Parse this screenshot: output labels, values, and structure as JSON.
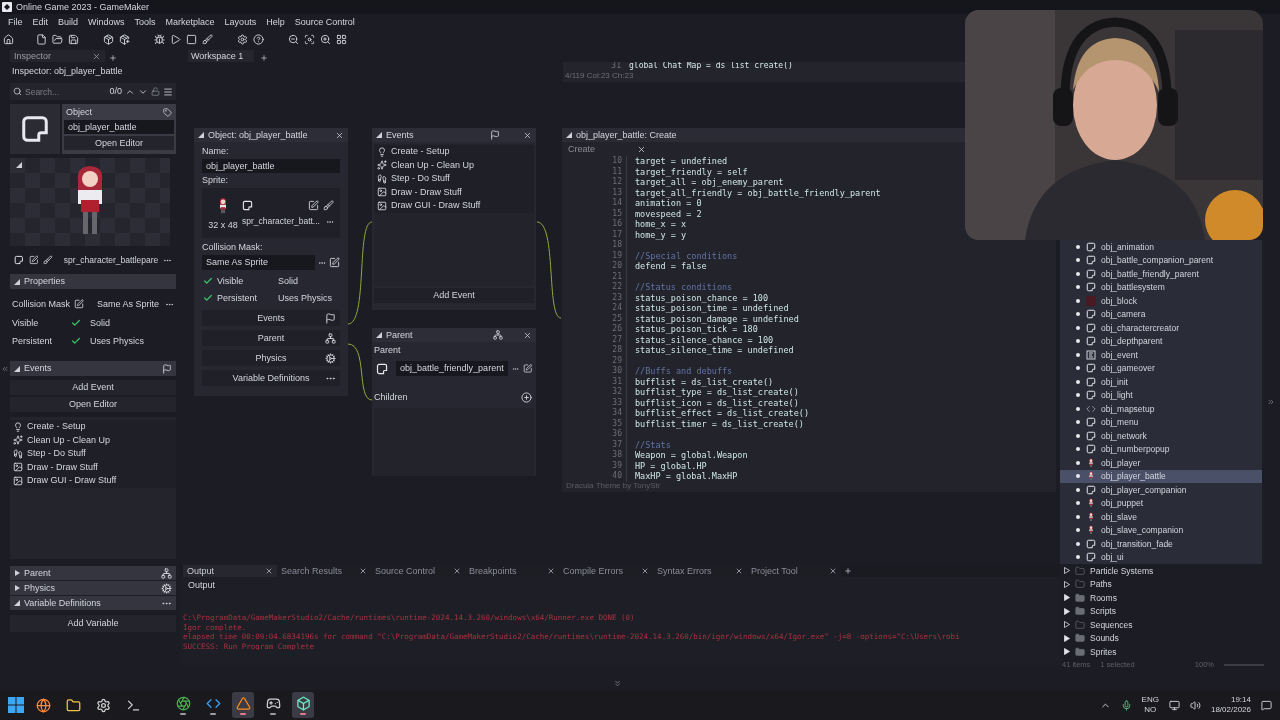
{
  "window": {
    "title": "Online Game 2023 - GameMaker"
  },
  "menu": [
    "File",
    "Edit",
    "Build",
    "Windows",
    "Tools",
    "Marketplace",
    "Layouts",
    "Help",
    "Source Control"
  ],
  "inspector": {
    "tab": "Inspector",
    "title": "Inspector: obj_player_battle",
    "search": {
      "placeholder": "Search...",
      "count": "0/0"
    },
    "object_label": "Object",
    "object_name": "obj_player_battle",
    "open_editor": "Open Editor",
    "sprite": "spr_character_battlepare",
    "properties": {
      "label": "Properties",
      "expanded": true,
      "collision_mask_label": "Collision Mask",
      "collision_mask": "Same As Sprite",
      "flags": [
        {
          "label": "Visible",
          "checked": true
        },
        {
          "label": "Solid",
          "checked": false
        },
        {
          "label": "Persistent",
          "checked": true
        },
        {
          "label": "Uses Physics",
          "checked": false
        }
      ]
    },
    "events": {
      "label": "Events",
      "expanded": true,
      "add_button": "Add Event",
      "open_button": "Open Editor",
      "items": [
        {
          "kind": "create",
          "label": "Create - Setup"
        },
        {
          "kind": "cleanup",
          "label": "Clean Up - Clean Up"
        },
        {
          "kind": "step",
          "label": "Step - Do Stuff"
        },
        {
          "kind": "draw",
          "label": "Draw - Draw Stuff"
        },
        {
          "kind": "draw",
          "label": "Draw GUI - Draw Stuff"
        }
      ]
    },
    "sections": [
      {
        "label": "Parent",
        "expanded": false,
        "kind": "parent"
      },
      {
        "label": "Physics",
        "expanded": false,
        "kind": "physics"
      },
      {
        "label": "Variable Definitions",
        "expanded": true,
        "kind": "more"
      }
    ],
    "add_variable": "Add Variable"
  },
  "workspace_tab": "Workspace 1",
  "background_editor": {
    "line_num": "31",
    "line": "global Chat Map = ds list create()",
    "status": "4/119 Col:23 Ch:23"
  },
  "object_window": {
    "title": "Object: obj_player_battle",
    "name_label": "Name:",
    "name": "obj_player_battle",
    "sprite_label": "Sprite:",
    "sprite": "spr_character_batt...",
    "sprite_size": "32 x 48",
    "collision_label": "Collision Mask:",
    "collision_mask": "Same As Sprite",
    "flags": [
      {
        "label": "Visible",
        "checked": true
      },
      {
        "label": "Solid",
        "checked": false
      },
      {
        "label": "Persistent",
        "checked": true
      },
      {
        "label": "Uses Physics",
        "checked": false
      }
    ],
    "buttons": [
      {
        "label": "Events",
        "kind": "events"
      },
      {
        "label": "Parent",
        "kind": "parent"
      },
      {
        "label": "Physics",
        "kind": "physics"
      },
      {
        "label": "Variable Definitions",
        "kind": "more"
      }
    ]
  },
  "events_window": {
    "title": "Events",
    "add_button": "Add Event",
    "items": [
      {
        "kind": "create",
        "label": "Create - Setup"
      },
      {
        "kind": "cleanup",
        "label": "Clean Up - Clean Up"
      },
      {
        "kind": "step",
        "label": "Step - Do Stuff"
      },
      {
        "kind": "draw",
        "label": "Draw - Draw Stuff"
      },
      {
        "kind": "draw",
        "label": "Draw GUI - Draw Stuff"
      }
    ]
  },
  "parent_window": {
    "title": "Parent",
    "parent_label": "Parent",
    "parent": "obj_battle_friendly_parent",
    "children_label": "Children"
  },
  "code_window": {
    "title": "obj_player_battle: Create",
    "tab": "Create",
    "footer": "Dracula Theme by TonyStr",
    "lines": [
      {
        "num": "10",
        "kind": "code",
        "text": "target = undefined"
      },
      {
        "num": "11",
        "kind": "code",
        "text": "target_friendly = self"
      },
      {
        "num": "12",
        "kind": "code",
        "text": "target_all = obj_enemy_parent"
      },
      {
        "num": "13",
        "kind": "code",
        "text": "target_all_friendly = obj_battle_friendly_parent"
      },
      {
        "num": "14",
        "kind": "code",
        "text": "animation = 0"
      },
      {
        "num": "15",
        "kind": "code",
        "text": "movespeed = 2"
      },
      {
        "num": "16",
        "kind": "code",
        "text": "home_x = x"
      },
      {
        "num": "17",
        "kind": "code",
        "text": "home_y = y"
      },
      {
        "num": "18"
      },
      {
        "num": "19",
        "kind": "comment",
        "text": "//Special conditions"
      },
      {
        "num": "20",
        "kind": "code",
        "text": "defend = false"
      },
      {
        "num": "21"
      },
      {
        "num": "22",
        "kind": "comment",
        "text": "//Status conditions"
      },
      {
        "num": "23",
        "kind": "code",
        "text": "status_poison_chance = 100"
      },
      {
        "num": "24",
        "kind": "code",
        "text": "status_poison_time = undefined"
      },
      {
        "num": "25",
        "kind": "code",
        "text": "status_poison_damage = undefined"
      },
      {
        "num": "26",
        "kind": "code",
        "text": "status_poison_tick = 180"
      },
      {
        "num": "27",
        "kind": "code",
        "text": "status_silence_chance = 100"
      },
      {
        "num": "28",
        "kind": "code",
        "text": "status_silence_time = undefined"
      },
      {
        "num": "29"
      },
      {
        "num": "30",
        "kind": "comment",
        "text": "//Buffs and debuffs"
      },
      {
        "num": "31",
        "kind": "code",
        "text": "bufflist = ds_list_create()"
      },
      {
        "num": "32",
        "kind": "code",
        "text": "bufflist_type = ds_list_create()"
      },
      {
        "num": "33",
        "kind": "code",
        "text": "bufflist_icon = ds_list_create()"
      },
      {
        "num": "34",
        "kind": "code",
        "text": "bufflist_effect = ds_list_create()"
      },
      {
        "num": "35",
        "kind": "code",
        "text": "bufflist_timer = ds_list_create()"
      },
      {
        "num": "36"
      },
      {
        "num": "37",
        "kind": "comment",
        "text": "//Stats"
      },
      {
        "num": "38",
        "kind": "code",
        "text": "Weapon = global.Weapon"
      },
      {
        "num": "39",
        "kind": "code",
        "text": "HP = global.HP"
      },
      {
        "num": "40",
        "kind": "code",
        "text": "MaxHP = global.MaxHP"
      }
    ]
  },
  "output": {
    "title": "Output",
    "tabs": [
      {
        "label": "Output",
        "selected": true
      },
      {
        "label": "Search Results",
        "selected": false
      },
      {
        "label": "Source Control",
        "selected": false
      },
      {
        "label": "Breakpoints",
        "selected": false
      },
      {
        "label": "Compile Errors",
        "selected": false
      },
      {
        "label": "Syntax Errors",
        "selected": false
      },
      {
        "label": "Project Tool",
        "selected": false
      }
    ],
    "lines": [
      "C:\\ProgramData/GameMakerStudio2/Cache/runtimes\\runtime-2024.14.3.260/windows\\x64/Runner.exe DONE (0)",
      "Igor complete.",
      "elapsed time 00:09:04.6834196s for command \"C:\\ProgramData/GameMakerStudio2/Cache/runtimes\\runtime-2024.14.3.260/bin/igor/windows/x64/Igor.exe\" -j=8  -options=\"C:\\Users\\robi",
      "SUCCESS: Run Program Complete"
    ]
  },
  "assets": {
    "items": [
      {
        "name": "obj_animation",
        "kind": "object",
        "selected": false
      },
      {
        "name": "obj_battle_companion_parent",
        "kind": "object",
        "selected": false
      },
      {
        "name": "obj_battle_friendly_parent",
        "kind": "object",
        "selected": false
      },
      {
        "name": "obj_battlesystem",
        "kind": "object",
        "selected": false
      },
      {
        "name": "obj_block",
        "kind": "solid",
        "selected": false
      },
      {
        "name": "obj_camera",
        "kind": "object",
        "selected": false
      },
      {
        "name": "obj_charactercreator",
        "kind": "object",
        "selected": false
      },
      {
        "name": "obj_depthparent",
        "kind": "object",
        "selected": false
      },
      {
        "name": "obj_event",
        "kind": "event",
        "selected": false
      },
      {
        "name": "obj_gameover",
        "kind": "object",
        "selected": false
      },
      {
        "name": "obj_init",
        "kind": "object",
        "selected": false
      },
      {
        "name": "obj_light",
        "kind": "object",
        "selected": false
      },
      {
        "name": "obj_mapsetup",
        "kind": "script",
        "selected": false
      },
      {
        "name": "obj_menu",
        "kind": "object",
        "selected": false
      },
      {
        "name": "obj_network",
        "kind": "object",
        "selected": false
      },
      {
        "name": "obj_numberpopup",
        "kind": "object",
        "selected": false
      },
      {
        "name": "obj_player",
        "kind": "sprite",
        "selected": false
      },
      {
        "name": "obj_player_battle",
        "kind": "sprite",
        "selected": true
      },
      {
        "name": "obj_player_companion",
        "kind": "object",
        "selected": false
      },
      {
        "name": "obj_puppet",
        "kind": "sprite",
        "selected": false
      },
      {
        "name": "obj_slave",
        "kind": "sprite",
        "selected": false
      },
      {
        "name": "obj_slave_companion",
        "kind": "sprite",
        "selected": false
      },
      {
        "name": "obj_transition_fade",
        "kind": "object",
        "selected": false
      },
      {
        "name": "obj_ui",
        "kind": "object",
        "selected": false
      }
    ],
    "folders": [
      {
        "name": "Particle Systems",
        "empty": true
      },
      {
        "name": "Paths",
        "empty": true
      },
      {
        "name": "Rooms",
        "empty": false
      },
      {
        "name": "Scripts",
        "empty": false
      },
      {
        "name": "Sequences",
        "empty": true
      },
      {
        "name": "Sounds",
        "empty": false
      },
      {
        "name": "Sprites",
        "empty": false
      }
    ],
    "status": {
      "items": "41 items",
      "selected": "1 selected",
      "zoom": "100%"
    }
  },
  "taskbar": {
    "apps": [
      {
        "kind": "browser",
        "running": false,
        "focused": false
      },
      {
        "kind": "files",
        "running": false,
        "focused": false
      },
      {
        "kind": "settings",
        "running": false,
        "focused": false
      },
      {
        "kind": "terminal",
        "running": false,
        "focused": false
      },
      {
        "kind": "chrome",
        "running": true,
        "focused": false
      },
      {
        "kind": "code",
        "running": true,
        "focused": false
      },
      {
        "kind": "cone",
        "running": true,
        "focused": true
      },
      {
        "kind": "game",
        "running": true,
        "focused": false
      },
      {
        "kind": "box",
        "running": true,
        "focused": true
      }
    ],
    "lang": "ENG",
    "region": "NO",
    "time": "19:14",
    "date": "18/02/2026"
  }
}
